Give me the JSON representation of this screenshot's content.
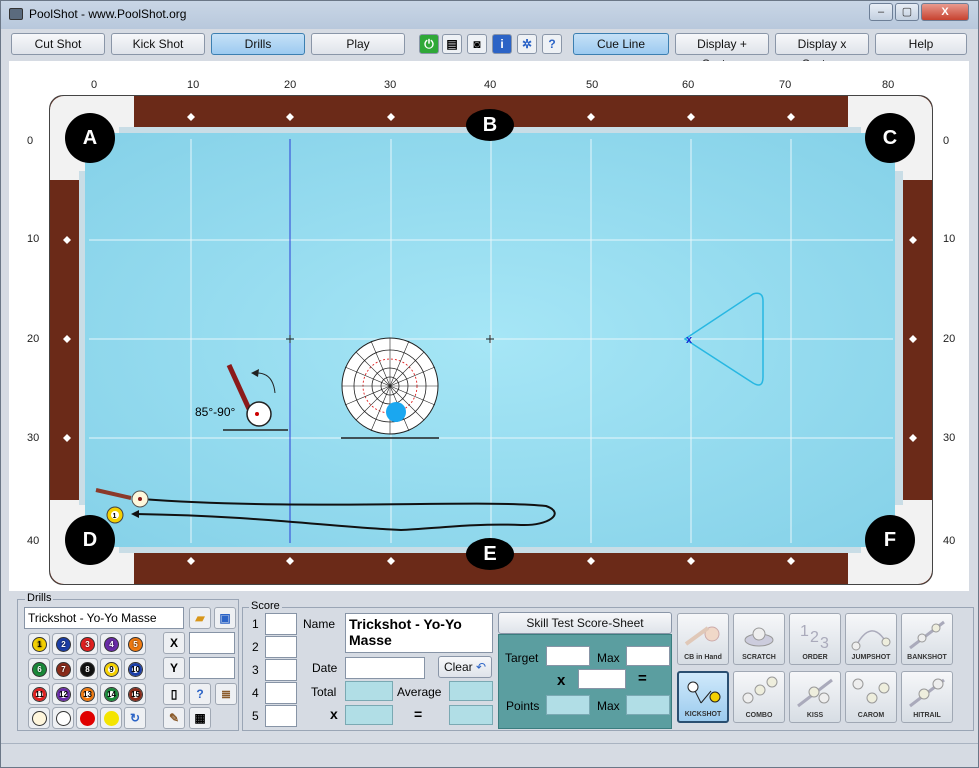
{
  "window": {
    "title": "PoolShot - www.PoolShot.org",
    "controls": [
      "–",
      "▢",
      "X"
    ]
  },
  "toolbar": {
    "buttons": [
      {
        "label": "Cut Shot",
        "active": false
      },
      {
        "label": "Kick Shot",
        "active": false
      },
      {
        "label": "Drills",
        "active": true
      },
      {
        "label": "Play",
        "active": false
      },
      {
        "label": "Cue Line",
        "active": true
      },
      {
        "label": "Display + System",
        "active": false
      },
      {
        "label": "Display x System",
        "active": false
      },
      {
        "label": "Help",
        "active": false
      }
    ],
    "icons": [
      "power-icon",
      "printer-icon",
      "camera-icon",
      "info-icon",
      "gear-icon",
      "help-doc-icon"
    ]
  },
  "table": {
    "x_ticks": [
      "0",
      "10",
      "20",
      "30",
      "40",
      "50",
      "60",
      "70",
      "80"
    ],
    "y_ticks": [
      "0",
      "10",
      "20",
      "30",
      "40"
    ],
    "pockets": [
      "A",
      "B",
      "C",
      "D",
      "E",
      "F"
    ],
    "angle_label": "85°-90°",
    "balls_on_table": [
      "cue",
      "1"
    ]
  },
  "drills": {
    "group_title": "Drills",
    "selected_drill": "Trickshot - Yo-Yo Masse",
    "balls": [
      "1",
      "2",
      "3",
      "4",
      "5",
      "6",
      "7",
      "8",
      "9",
      "10",
      "11",
      "12",
      "13",
      "14",
      "15"
    ],
    "ball_colors": [
      "#f4d000",
      "#1b3ea8",
      "#e02020",
      "#6a2ca8",
      "#f07a10",
      "#1a8a3a",
      "#8a2b1a",
      "#111111",
      "#f4d000",
      "#1b3ea8",
      "#e02020",
      "#6a2ca8",
      "#f07a10",
      "#1a8a3a",
      "#8a2b1a"
    ],
    "x_label": "X",
    "y_label": "Y",
    "x_value": "",
    "y_value": ""
  },
  "score": {
    "group_title": "Score",
    "rows": [
      "1",
      "2",
      "3",
      "4",
      "5"
    ],
    "name_label": "Name",
    "name_value": "Trickshot - Yo-Yo Masse",
    "date_label": "Date",
    "clear_label": "Clear",
    "total_label": "Total",
    "average_label": "Average",
    "x_label": "x",
    "eq_label": "=",
    "skill_test_label": "Skill Test Score-Sheet",
    "target_label": "Target",
    "max_label": "Max",
    "points_label": "Points"
  },
  "shot_types": [
    "CB in Hand",
    "SCRATCH",
    "ORDER",
    "JUMPSHOT",
    "BANKSHOT",
    "KICKSHOT",
    "COMBO",
    "KISS",
    "CAROM",
    "HITRAIL"
  ],
  "shot_active": "KICKSHOT",
  "statusbar": {
    "text": ""
  }
}
